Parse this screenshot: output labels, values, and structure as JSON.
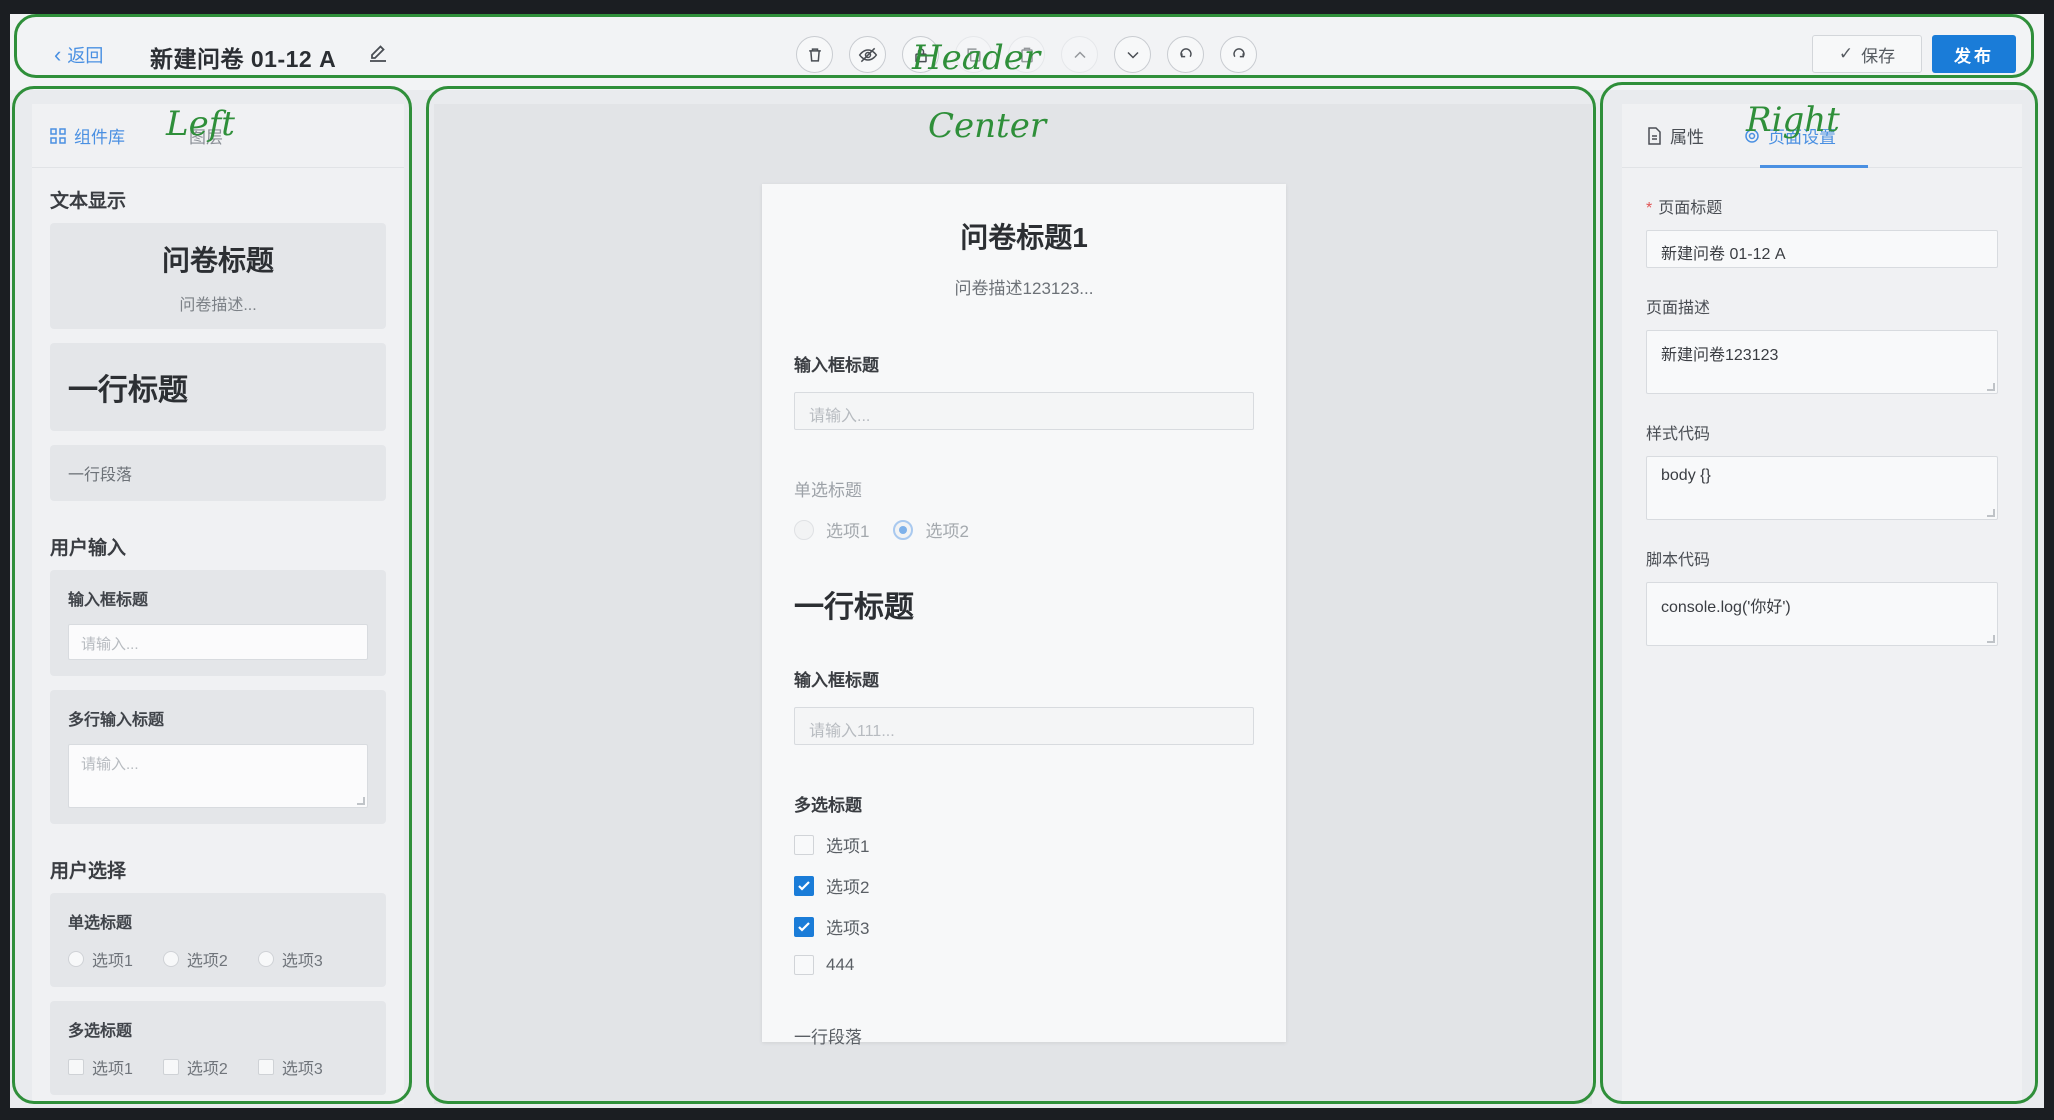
{
  "header": {
    "back_label": "返回",
    "title": "新建问卷 01-12 A",
    "save_label": "保存",
    "publish_label": "发布",
    "toolbar_icons": [
      "trash-icon",
      "eye-off-icon",
      "lock-icon",
      "copy-icon",
      "paste-icon",
      "arrow-up-icon",
      "arrow-down-icon",
      "undo-icon",
      "redo-icon"
    ]
  },
  "left": {
    "tabs": [
      {
        "label": "组件库",
        "icon": "grid-icon",
        "active": true
      },
      {
        "label": "图层",
        "icon": "layers-icon",
        "active": false
      }
    ],
    "groups": {
      "text_display": "文本显示",
      "user_input": "用户输入",
      "user_select": "用户选择"
    },
    "items": {
      "title_card": {
        "title": "问卷标题",
        "desc": "问卷描述..."
      },
      "heading_card": "一行标题",
      "paragraph_card": "一行段落",
      "input_card": {
        "label": "输入框标题",
        "placeholder": "请输入..."
      },
      "textarea_card": {
        "label": "多行输入标题",
        "placeholder": "请输入..."
      },
      "radio_card": {
        "label": "单选标题",
        "options": [
          "选项1",
          "选项2",
          "选项3"
        ]
      },
      "checkbox_card": {
        "label": "多选标题",
        "options": [
          "选项1",
          "选项2",
          "选项3"
        ]
      }
    }
  },
  "canvas": {
    "title": "问卷标题1",
    "desc": "问卷描述123123...",
    "input1": {
      "label": "输入框标题",
      "placeholder": "请输入..."
    },
    "radio": {
      "label": "单选标题",
      "options": [
        "选项1",
        "选项2"
      ],
      "selected": "选项2"
    },
    "heading": "一行标题",
    "input2": {
      "label": "输入框标题",
      "placeholder": "请输入111..."
    },
    "checkbox": {
      "label": "多选标题",
      "options": [
        "选项1",
        "选项2",
        "选项3",
        "444"
      ],
      "checked": [
        "选项2",
        "选项3"
      ]
    },
    "paragraph": "一行段落"
  },
  "right": {
    "tabs": [
      {
        "label": "属性",
        "icon": "file-icon",
        "active": false
      },
      {
        "label": "页面设置",
        "icon": "gear-icon",
        "active": true
      }
    ],
    "fields": {
      "page_title": {
        "label": "页面标题",
        "value": "新建问卷 01-12 A",
        "required": true
      },
      "page_desc": {
        "label": "页面描述",
        "value": "新建问卷123123"
      },
      "style_code": {
        "label": "样式代码",
        "value": "body {}"
      },
      "script_code": {
        "label": "脚本代码",
        "value": "console.log('你好')"
      }
    }
  },
  "annotations": {
    "header": "Header",
    "left": "Left",
    "center": "Center",
    "right": "Right",
    "color": "#2f8f3a"
  },
  "colors": {
    "accent": "#1a7cd8",
    "link": "#4a90e2"
  }
}
